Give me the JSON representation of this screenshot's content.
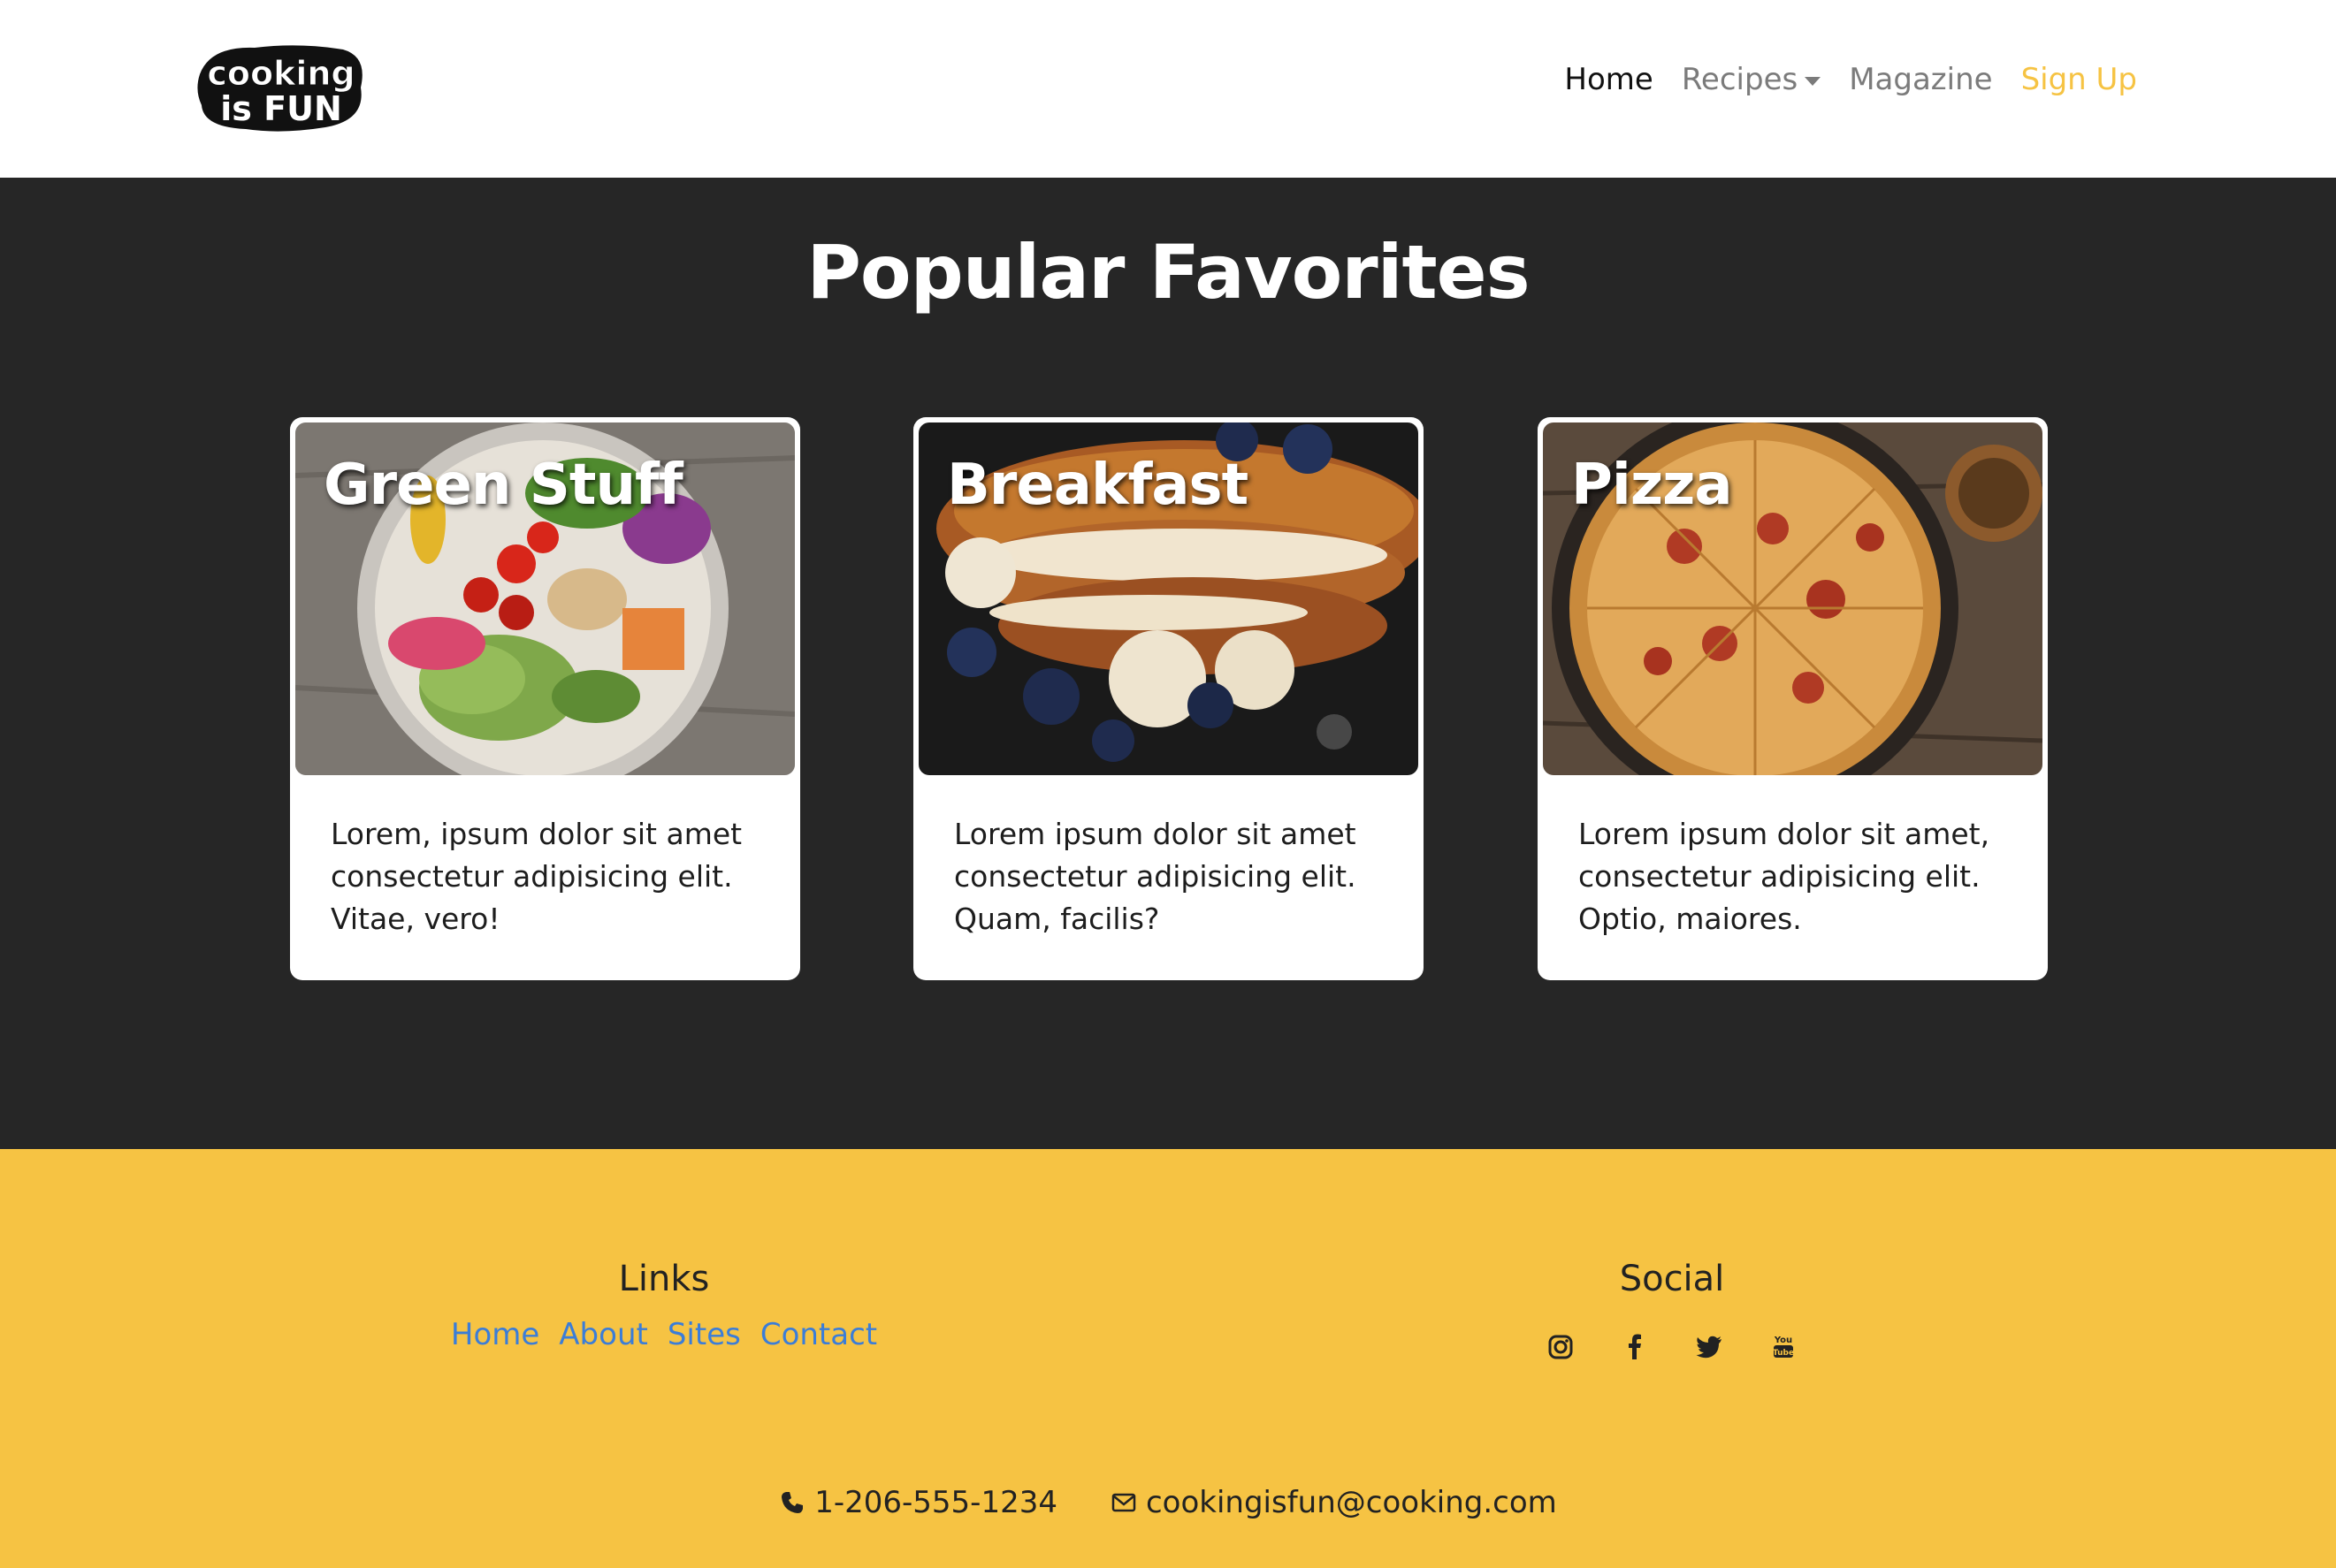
{
  "header": {
    "logo_text_1": "cooking",
    "logo_text_2": "is FUN",
    "nav": [
      {
        "label": "Home"
      },
      {
        "label": "Recipes"
      },
      {
        "label": "Magazine"
      },
      {
        "label": "Sign Up"
      }
    ]
  },
  "main": {
    "title": "Popular Favorites",
    "cards": [
      {
        "title": "Green Stuff",
        "text": "Lorem, ipsum dolor sit amet consectetur adipisicing elit. Vitae, vero!"
      },
      {
        "title": "Breakfast",
        "text": "Lorem ipsum dolor sit amet consectetur adipisicing elit. Quam, facilis?"
      },
      {
        "title": "Pizza",
        "text": "Lorem ipsum dolor sit amet, consectetur adipisicing elit. Optio, maiores."
      }
    ]
  },
  "footer": {
    "links_heading": "Links",
    "links": [
      {
        "label": "Home"
      },
      {
        "label": "About"
      },
      {
        "label": "Sites"
      },
      {
        "label": "Contact"
      }
    ],
    "social_heading": "Social",
    "social": [
      "instagram-icon",
      "facebook-icon",
      "twitter-icon",
      "youtube-icon"
    ],
    "phone": "1-206-555-1234",
    "email": "cookingisfun@cooking.com"
  },
  "colors": {
    "accent": "#f6c343",
    "dark": "#262626",
    "link": "#3b7dd8"
  }
}
